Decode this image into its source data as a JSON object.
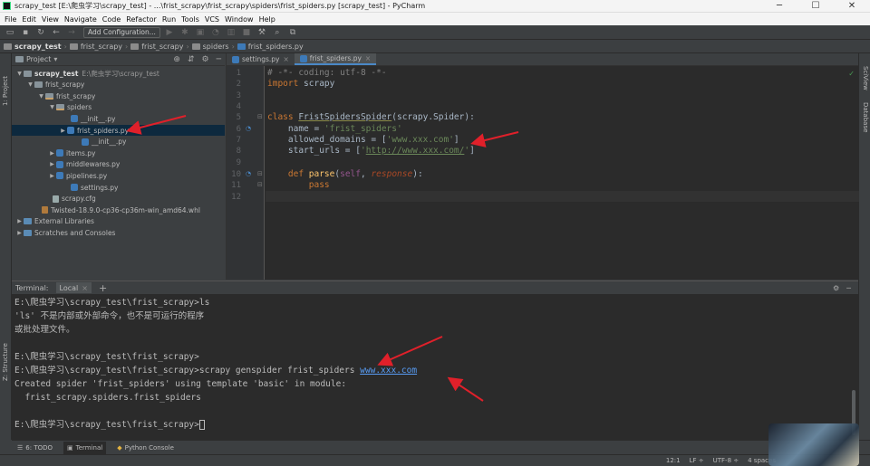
{
  "window": {
    "title": "scrapy_test [E:\\爬虫学习\\scrapy_test] - ...\\frist_scrapy\\frist_scrapy\\spiders\\frist_spiders.py [scrapy_test] - PyCharm",
    "minimize": "─",
    "maximize": "☐",
    "close": "✕"
  },
  "menu": [
    "File",
    "Edit",
    "View",
    "Navigate",
    "Code",
    "Refactor",
    "Run",
    "Tools",
    "VCS",
    "Window",
    "Help"
  ],
  "toolbar": {
    "add_configuration": "Add Configuration..."
  },
  "breadcrumb": [
    "scrapy_test",
    "frist_scrapy",
    "frist_scrapy",
    "spiders",
    "frist_spiders.py"
  ],
  "project_panel": {
    "title": "Project",
    "tree": [
      {
        "label": "scrapy_test",
        "note": "E:\\爬虫学习\\scrapy_test",
        "icon": "folder",
        "arrow": "▼",
        "bold": true
      },
      {
        "label": "frist_scrapy",
        "icon": "folder",
        "arrow": "▼"
      },
      {
        "label": "frist_scrapy",
        "icon": "pkg",
        "arrow": "▼"
      },
      {
        "label": "spiders",
        "icon": "pkg",
        "arrow": "▼"
      },
      {
        "label": "__init__.py",
        "icon": "py",
        "arrow": ""
      },
      {
        "label": "frist_spiders.py",
        "icon": "py",
        "arrow": "▶",
        "selected": true
      },
      {
        "label": "__init__.py",
        "icon": "py",
        "arrow": ""
      },
      {
        "label": "items.py",
        "icon": "py",
        "arrow": "▶"
      },
      {
        "label": "middlewares.py",
        "icon": "py",
        "arrow": "▶"
      },
      {
        "label": "pipelines.py",
        "icon": "py",
        "arrow": "▶"
      },
      {
        "label": "settings.py",
        "icon": "py",
        "arrow": ""
      },
      {
        "label": "scrapy.cfg",
        "icon": "cfg",
        "arrow": ""
      },
      {
        "label": "Twisted-18.9.0-cp36-cp36m-win_amd64.whl",
        "icon": "whl",
        "arrow": ""
      },
      {
        "label": "External Libraries",
        "icon": "lib",
        "arrow": "▶"
      },
      {
        "label": "Scratches and Consoles",
        "icon": "lib",
        "arrow": "▶"
      }
    ]
  },
  "side_tabs": {
    "project": "1: Project",
    "structure": "Z: Structure",
    "favorites": "2: Favorites",
    "scview": "SciView",
    "database": "Database"
  },
  "editor": {
    "tabs": [
      {
        "label": "settings.py",
        "active": false
      },
      {
        "label": "frist_spiders.py",
        "active": true
      }
    ],
    "line_numbers": [
      "1",
      "2",
      "3",
      "4",
      "5",
      "6",
      "7",
      "8",
      "9",
      "10",
      "11",
      "12"
    ],
    "code": {
      "l1": "# -*- coding: utf-8 -*-",
      "l2_kw": "import",
      "l2_rest": " scrapy",
      "l5_kw": "class ",
      "l5_cls": "FristSpidersSpider",
      "l5_rest": "(scrapy.Spider):",
      "l6_a": "    name = ",
      "l6_s": "'frist_spiders'",
      "l7_a": "    allowed_domains = [",
      "l7_s": "'www.xxx.com'",
      "l7_b": "]",
      "l8_a": "    start_urls = [",
      "l8_s1": "'",
      "l8_s2": "http://www.xxx.com/",
      "l8_s3": "'",
      "l8_b": "]",
      "l10_kw": "    def ",
      "l10_fn": "parse",
      "l10_p": "(",
      "l10_self": "self",
      "l10_c": ", ",
      "l10_resp": "response",
      "l10_e": "):",
      "l11_kw": "        pass"
    }
  },
  "terminal": {
    "label": "Terminal:",
    "tab": "Local",
    "lines": [
      "E:\\爬虫学习\\scrapy_test\\frist_scrapy>ls",
      "'ls' 不是内部或外部命令，也不是可运行的程序",
      "或批处理文件。",
      "",
      "E:\\爬虫学习\\scrapy_test\\frist_scrapy>",
      "E:\\爬虫学习\\scrapy_test\\frist_scrapy>scrapy genspider frist_spiders ",
      "Created spider 'frist_spiders' using template 'basic' in module:",
      "  frist_scrapy.spiders.frist_spiders",
      "",
      "E:\\爬虫学习\\scrapy_test\\frist_scrapy>"
    ],
    "link": "www.xxx.com"
  },
  "bottom_tabs": [
    {
      "icon": "☰",
      "label": "6: TODO",
      "active": false
    },
    {
      "icon": "▣",
      "label": "Terminal",
      "active": true
    },
    {
      "icon": "◆",
      "label": "Python Console",
      "active": false
    }
  ],
  "status": {
    "position": "12:1",
    "line_sep": "LF ÷",
    "encoding": "UTF-8 ÷",
    "indent": "4 spaces"
  },
  "colors": {
    "accent": "#4a88c7",
    "annotation_arrow": "#e0202a"
  }
}
